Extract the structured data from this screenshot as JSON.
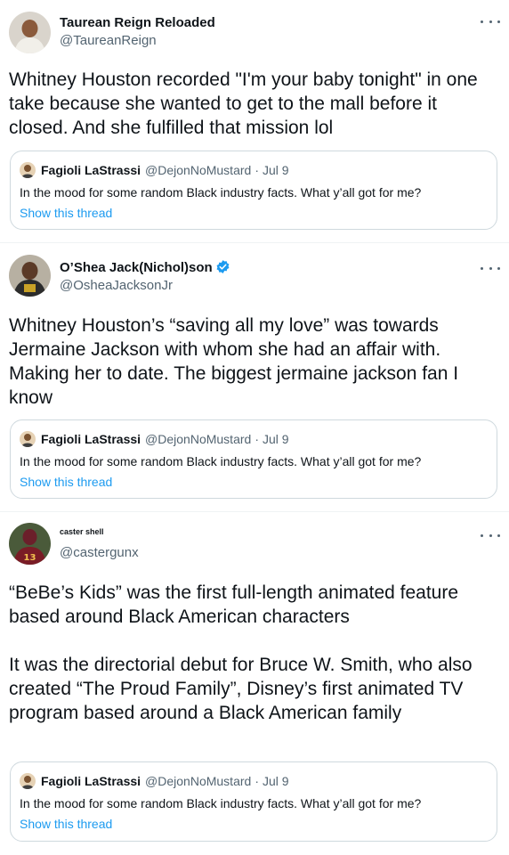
{
  "tweets": [
    {
      "name": "Taurean Reign Reloaded",
      "handle": "@TaureanReign",
      "verified": false,
      "text": "Whitney Houston recorded \"I'm your baby tonight\" in one take because she wanted to get to the mall before it closed. And she fulfilled that mission lol",
      "quote": {
        "name": "Fagioli LaStrassi",
        "handle": "@DejonNoMustard",
        "date": "Jul 9",
        "text": "In the mood for some random Black industry facts. What y’all got for me?",
        "link": "Show this thread"
      }
    },
    {
      "name": "O’Shea Jack(Nichol)son",
      "handle": "@OsheaJacksonJr",
      "verified": true,
      "text": "Whitney Houston’s “saving all my love” was towards Jermaine Jackson with whom she had an affair with. Making her to date. The biggest jermaine jackson fan I know",
      "quote": {
        "name": "Fagioli LaStrassi",
        "handle": "@DejonNoMustard",
        "date": "Jul 9",
        "text": "In the mood for some random Black industry facts. What y’all got for me?",
        "link": "Show this thread"
      }
    },
    {
      "name": "caster shell",
      "handle": "@castergunx",
      "verified": false,
      "text": "“BeBe’s Kids” was the first full-length animated feature based around Black American characters\n\nIt was the directorial debut for Bruce W. Smith, who also created “The Proud Family”, Disney’s first animated TV program based around a Black American family",
      "quote": {
        "name": "Fagioli LaStrassi",
        "handle": "@DejonNoMustard",
        "date": "Jul 9",
        "text": "In the mood for some random Black industry facts. What y’all got for me?",
        "link": "Show this thread"
      }
    }
  ],
  "colors": {
    "text": "#0f1419",
    "secondary": "#536471",
    "link": "#1d9bf0",
    "border": "#cfd9de",
    "verified": "#1d9bf0"
  },
  "icons": {
    "more": "more-horizontal-icon",
    "verified": "verified-badge-icon"
  }
}
